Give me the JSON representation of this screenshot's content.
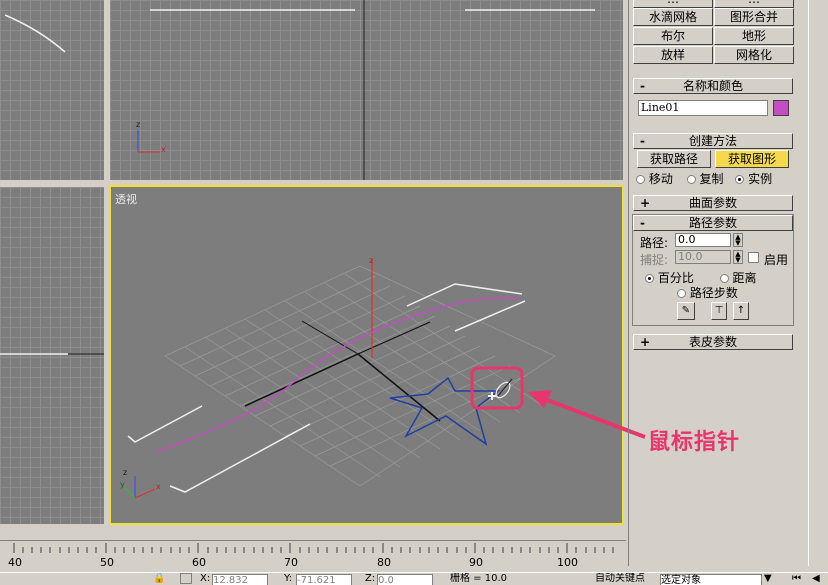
{
  "create_buttons": {
    "row0": [
      "…",
      "…"
    ],
    "row1": [
      "水滴网格",
      "图形合并"
    ],
    "row2": [
      "布尔",
      "地形"
    ],
    "row3": [
      "放样",
      "网格化"
    ]
  },
  "name_color": {
    "sign": "-",
    "title": "名称和颜色",
    "object_name": "Line01",
    "swatch_color": "#c44cc4"
  },
  "creation_method": {
    "sign": "-",
    "title": "创建方法",
    "get_path": "获取路径",
    "get_shape": "获取图形",
    "move": "移动",
    "copy": "复制",
    "instance": "实例"
  },
  "surface_params": {
    "sign": "+",
    "title": "曲面参数"
  },
  "path_params": {
    "sign": "-",
    "title": "路径参数",
    "path_label": "路径:",
    "path_value": "0.0",
    "snap_label": "捕捉:",
    "snap_value": "10.0",
    "enable_label": "启用",
    "percentage": "百分比",
    "distance": "距离",
    "path_steps": "路径步数"
  },
  "skin_params": {
    "sign": "+",
    "title": "表皮参数"
  },
  "viewport": {
    "label": "透视"
  },
  "annotation": {
    "label": "鼠标指针",
    "color": "#e8356b"
  },
  "axis_labels": {
    "x": "x",
    "y": "y",
    "z": "z"
  },
  "ruler": {
    "labels": [
      "40",
      "50",
      "60",
      "70",
      "80",
      "90",
      "100"
    ]
  },
  "statusbar": {
    "x_label": "X:",
    "x_value": "12.832",
    "y_label": "Y:",
    "y_value": "-71.621",
    "z_label": "Z:",
    "z_value": "0.0",
    "grid_label": "栅格 = 10.0",
    "autokey_label": "自动关键点",
    "selection_label": "选定对象"
  },
  "colors": {
    "active_viewport": "#f0e030",
    "highlight": "#f6d84c",
    "viewport_bg": "#7d7d7d"
  }
}
